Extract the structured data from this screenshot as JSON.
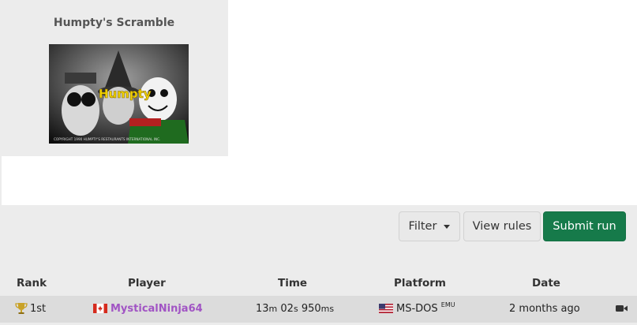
{
  "game": {
    "title": "Humpty's Scramble",
    "cover": {
      "logo_text": "Humpty",
      "copyright": "COPYRIGHT 1990 HUMPTY'S RESTAURANTS INTERNATIONAL INC."
    }
  },
  "toolbar": {
    "filter_label": "Filter",
    "view_rules_label": "View rules",
    "submit_label": "Submit run"
  },
  "table": {
    "headers": {
      "rank": "Rank",
      "player": "Player",
      "time": "Time",
      "platform": "Platform",
      "date": "Date"
    },
    "rows": [
      {
        "rank": "1st",
        "player": "MysticalNinja64",
        "player_flag": "canada-flag",
        "time": {
          "min": "13",
          "min_unit": "m",
          "sec": "02",
          "sec_unit": "s",
          "ms": "950",
          "ms_unit": "ms"
        },
        "platform": "MS-DOS",
        "platform_flag": "usa-flag",
        "emu": "EMU",
        "date": "2 months ago"
      }
    ]
  },
  "colors": {
    "player": "#a154c4",
    "submit": "#167a4a",
    "trophy": "#c9a227"
  }
}
